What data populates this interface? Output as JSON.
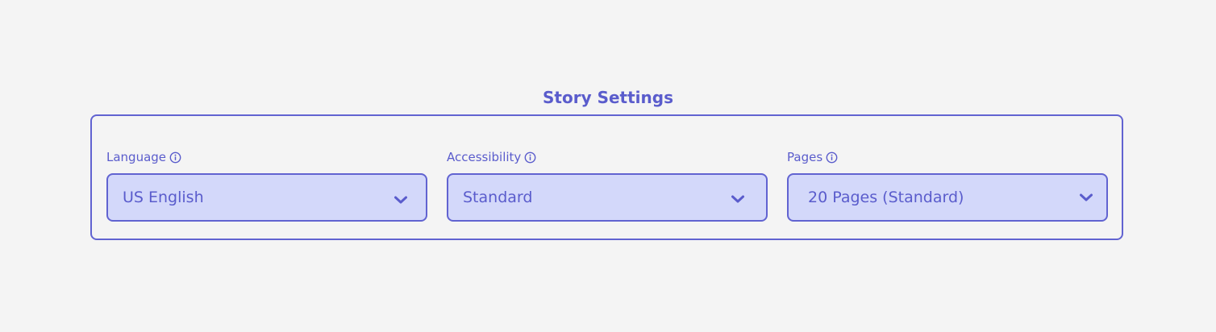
{
  "section": {
    "title": "Story Settings"
  },
  "fields": [
    {
      "label": "Language",
      "value": "US English",
      "info_icon": "info-circle-icon",
      "dropdown_icon": "chevron-down-icon"
    },
    {
      "label": "Accessibility",
      "value": "Standard",
      "info_icon": "info-circle-icon",
      "dropdown_icon": "chevron-down-icon"
    },
    {
      "label": "Pages",
      "value": "20 Pages (Standard)",
      "info_icon": "info-circle-icon",
      "dropdown_icon": "chevron-down-icon"
    }
  ],
  "colors": {
    "background": "#f4f4f4",
    "accent": "#6163d1",
    "text": "#5a5ccc",
    "select_fill": "#d3d8fa"
  }
}
